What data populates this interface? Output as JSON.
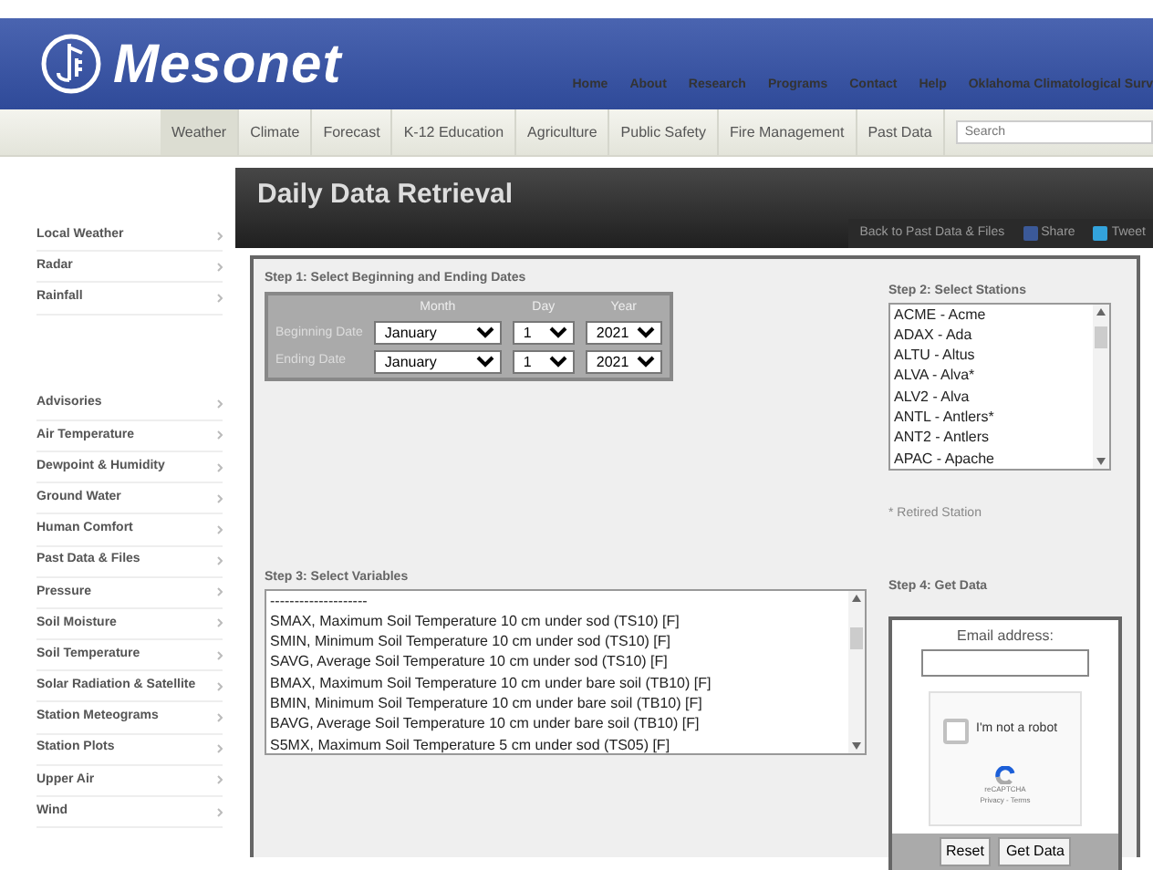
{
  "header": {
    "logo_text": "Mesonet",
    "links": [
      "Home",
      "About",
      "Research",
      "Programs",
      "Contact",
      "Help",
      "Oklahoma Climatological Surv"
    ]
  },
  "topnav": {
    "items": [
      {
        "label": "Weather",
        "selected": true
      },
      {
        "label": "Climate",
        "selected": false
      },
      {
        "label": "Forecast",
        "selected": false
      },
      {
        "label": "K-12 Education",
        "selected": false
      },
      {
        "label": "Agriculture",
        "selected": false
      },
      {
        "label": "Public Safety",
        "selected": false
      },
      {
        "label": "Fire Management",
        "selected": false
      },
      {
        "label": "Past Data",
        "selected": false
      }
    ],
    "search_placeholder": "Search"
  },
  "sidebar": {
    "groups": [
      [
        "Local Weather",
        "Radar",
        "Rainfall"
      ],
      [
        "Advisories",
        "Air Temperature",
        "Dewpoint & Humidity",
        "Ground Water",
        "Human Comfort",
        "Past Data & Files",
        "Pressure",
        "Soil Moisture",
        "Soil Temperature",
        "Solar Radiation & Satellite",
        "Station Meteograms",
        "Station Plots",
        "Upper Air",
        "Wind"
      ]
    ]
  },
  "page": {
    "title": "Daily Data Retrieval",
    "back_link": "Back to Past Data & Files",
    "share": "Share",
    "tweet": "Tweet"
  },
  "step1": {
    "label": "Step 1: Select Beginning and Ending Dates",
    "columns": [
      "Month",
      "Day",
      "Year"
    ],
    "rows": [
      {
        "label": "Beginning Date",
        "month": "January",
        "day": "1",
        "year": "2021"
      },
      {
        "label": "Ending Date",
        "month": "January",
        "day": "1",
        "year": "2021"
      }
    ]
  },
  "step2": {
    "label": "Step 2: Select Stations",
    "stations": [
      "ACME - Acme",
      "ADAX - Ada",
      "ALTU - Altus",
      "ALVA - Alva*",
      "ALV2 - Alva",
      "ANTL - Antlers*",
      "ANT2 - Antlers",
      "APAC - Apache"
    ],
    "note": "* Retired Station"
  },
  "step3": {
    "label": "Step 3: Select Variables",
    "variables": [
      "--------------------",
      "SMAX, Maximum Soil Temperature 10 cm under sod (TS10) [F]",
      "SMIN, Minimum Soil Temperature 10 cm under sod (TS10) [F]",
      "SAVG, Average Soil Temperature 10 cm under sod (TS10) [F]",
      "BMAX, Maximum Soil Temperature 10 cm under bare soil (TB10) [F]",
      "BMIN, Minimum Soil Temperature 10 cm under bare soil (TB10) [F]",
      "BAVG, Average Soil Temperature 10 cm under bare soil (TB10) [F]",
      "S5MX, Maximum Soil Temperature 5 cm under sod (TS05) [F]"
    ]
  },
  "step4": {
    "label": "Step 4: Get Data",
    "email_label": "Email address:",
    "captcha": {
      "checked": false,
      "label": "I'm not a robot",
      "brand": "reCAPTCHA",
      "links": "Privacy - Terms"
    },
    "buttons": [
      "Reset",
      "Get Data"
    ]
  }
}
